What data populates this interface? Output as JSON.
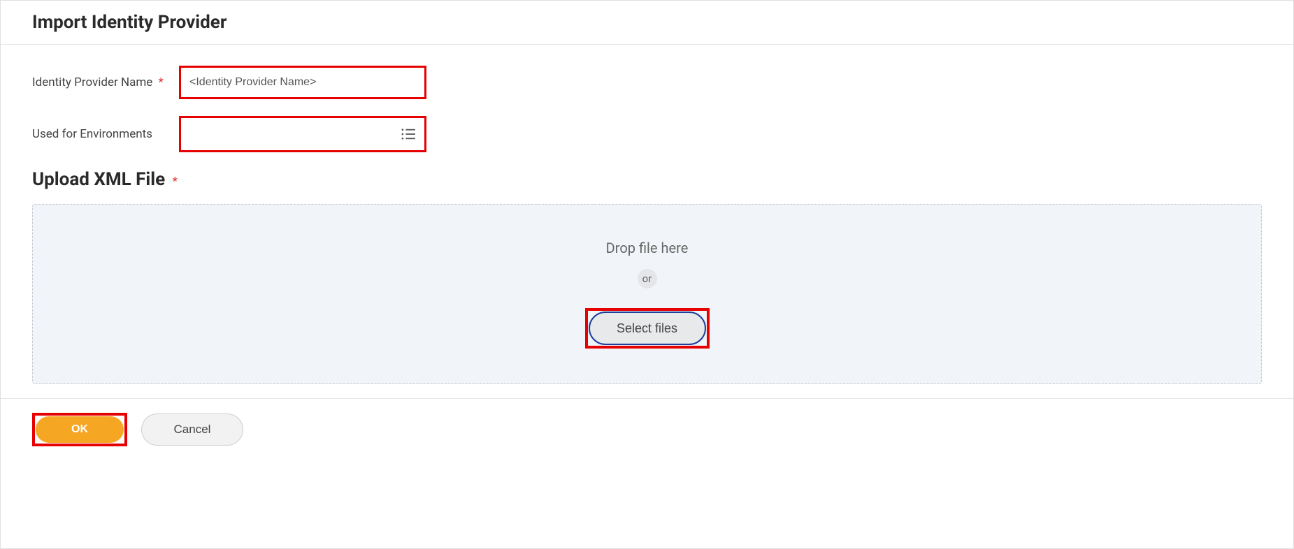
{
  "header": {
    "title": "Import Identity Provider"
  },
  "form": {
    "idp_name": {
      "label": "Identity Provider Name",
      "value": "<Identity Provider Name>",
      "required": true
    },
    "environments": {
      "label": "Used for Environments",
      "value": "",
      "required": false
    }
  },
  "upload": {
    "title": "Upload XML File",
    "required": true,
    "drop_text": "Drop file here",
    "or_label": "or",
    "select_button": "Select files"
  },
  "footer": {
    "ok_label": "OK",
    "cancel_label": "Cancel"
  }
}
